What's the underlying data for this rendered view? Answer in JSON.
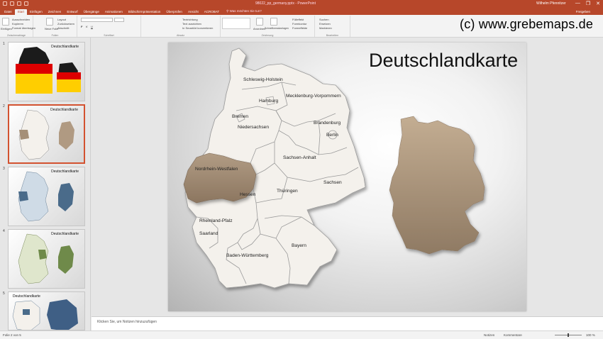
{
  "window": {
    "file_title": "98022_pp_germany.pptx  -  PowerPoint",
    "user": "Wilhelm Pfennitzer",
    "controls": [
      "—",
      "❐",
      "✕"
    ]
  },
  "tabs": [
    "Datei",
    "Start",
    "Einfügen",
    "Zeichnen",
    "Entwurf",
    "Übergänge",
    "Animationen",
    "Bildschirmpräsentation",
    "Überprüfen",
    "Ansicht",
    "ACROBAT"
  ],
  "active_tab": "Start",
  "tell_me": "Was möchten Sie tun?",
  "share": "Freigeben",
  "ribbon": {
    "clipboard": {
      "label": "Zwischenablage",
      "paste": "Einfügen",
      "cut": "Ausschneiden",
      "copy": "Kopieren",
      "format": "Format übertragen"
    },
    "slides": {
      "label": "Folien",
      "new": "Neue Folie",
      "layout": "Layout",
      "reset": "Zurücksetzen",
      "section": "Abschnitt"
    },
    "font": {
      "label": "Schriftart"
    },
    "paragraph": {
      "label": "Absatz",
      "direction": "Textrichtung",
      "align": "Text ausrichten",
      "smartart": "In SmartArt konvertieren"
    },
    "drawing": {
      "label": "Zeichnung",
      "arrange": "Anordnen",
      "styles": "Schnellformatvorlagen",
      "fill": "Fülleffekt",
      "outline": "Formkontur",
      "effects": "Formeffekte"
    },
    "editing": {
      "label": "Bearbeiten",
      "find": "Suchen",
      "replace": "Ersetzen",
      "select": "Markieren"
    }
  },
  "watermark": "(c) www.grebemaps.de",
  "thumbnails": [
    {
      "num": "1",
      "title": "Deutschlandkarte",
      "tooltip": "Deutschlandkarte"
    },
    {
      "num": "2",
      "title": "Deutschlandkarte"
    },
    {
      "num": "3",
      "title": "Deutschlandkarte"
    },
    {
      "num": "4",
      "title": "Deutschlandkarte"
    },
    {
      "num": "5",
      "title": "Deutschlandkarte"
    }
  ],
  "slide": {
    "title": "Deutschlandkarte",
    "states": {
      "sh": "Schleswig-Holstein",
      "mv": "Mecklenburg-Vorpommern",
      "hh": "Hamburg",
      "hb": "Bremen",
      "ni": "Niedersachsen",
      "bb": "Brandenburg",
      "be": "Berlin",
      "st": "Sachsen-Anhalt",
      "nw": "Nordrhein-Westfalen",
      "he": "Hessen",
      "th": "Thüringen",
      "sn": "Sachsen",
      "rp": "Rheinland-Pfalz",
      "sl": "Saarland",
      "bw": "Baden-Württemberg",
      "by": "Bayern"
    },
    "colors": {
      "map_fill": "#f4f1ec",
      "highlight": "#a58f77",
      "silhouette": "#b09a82"
    }
  },
  "notes_placeholder": "Klicken Sie, um Notizen hinzuzufügen",
  "status": {
    "slide": "Folie 2 von 5",
    "notes": "Notizen",
    "comments": "Kommentare",
    "zoom": "100 %"
  }
}
